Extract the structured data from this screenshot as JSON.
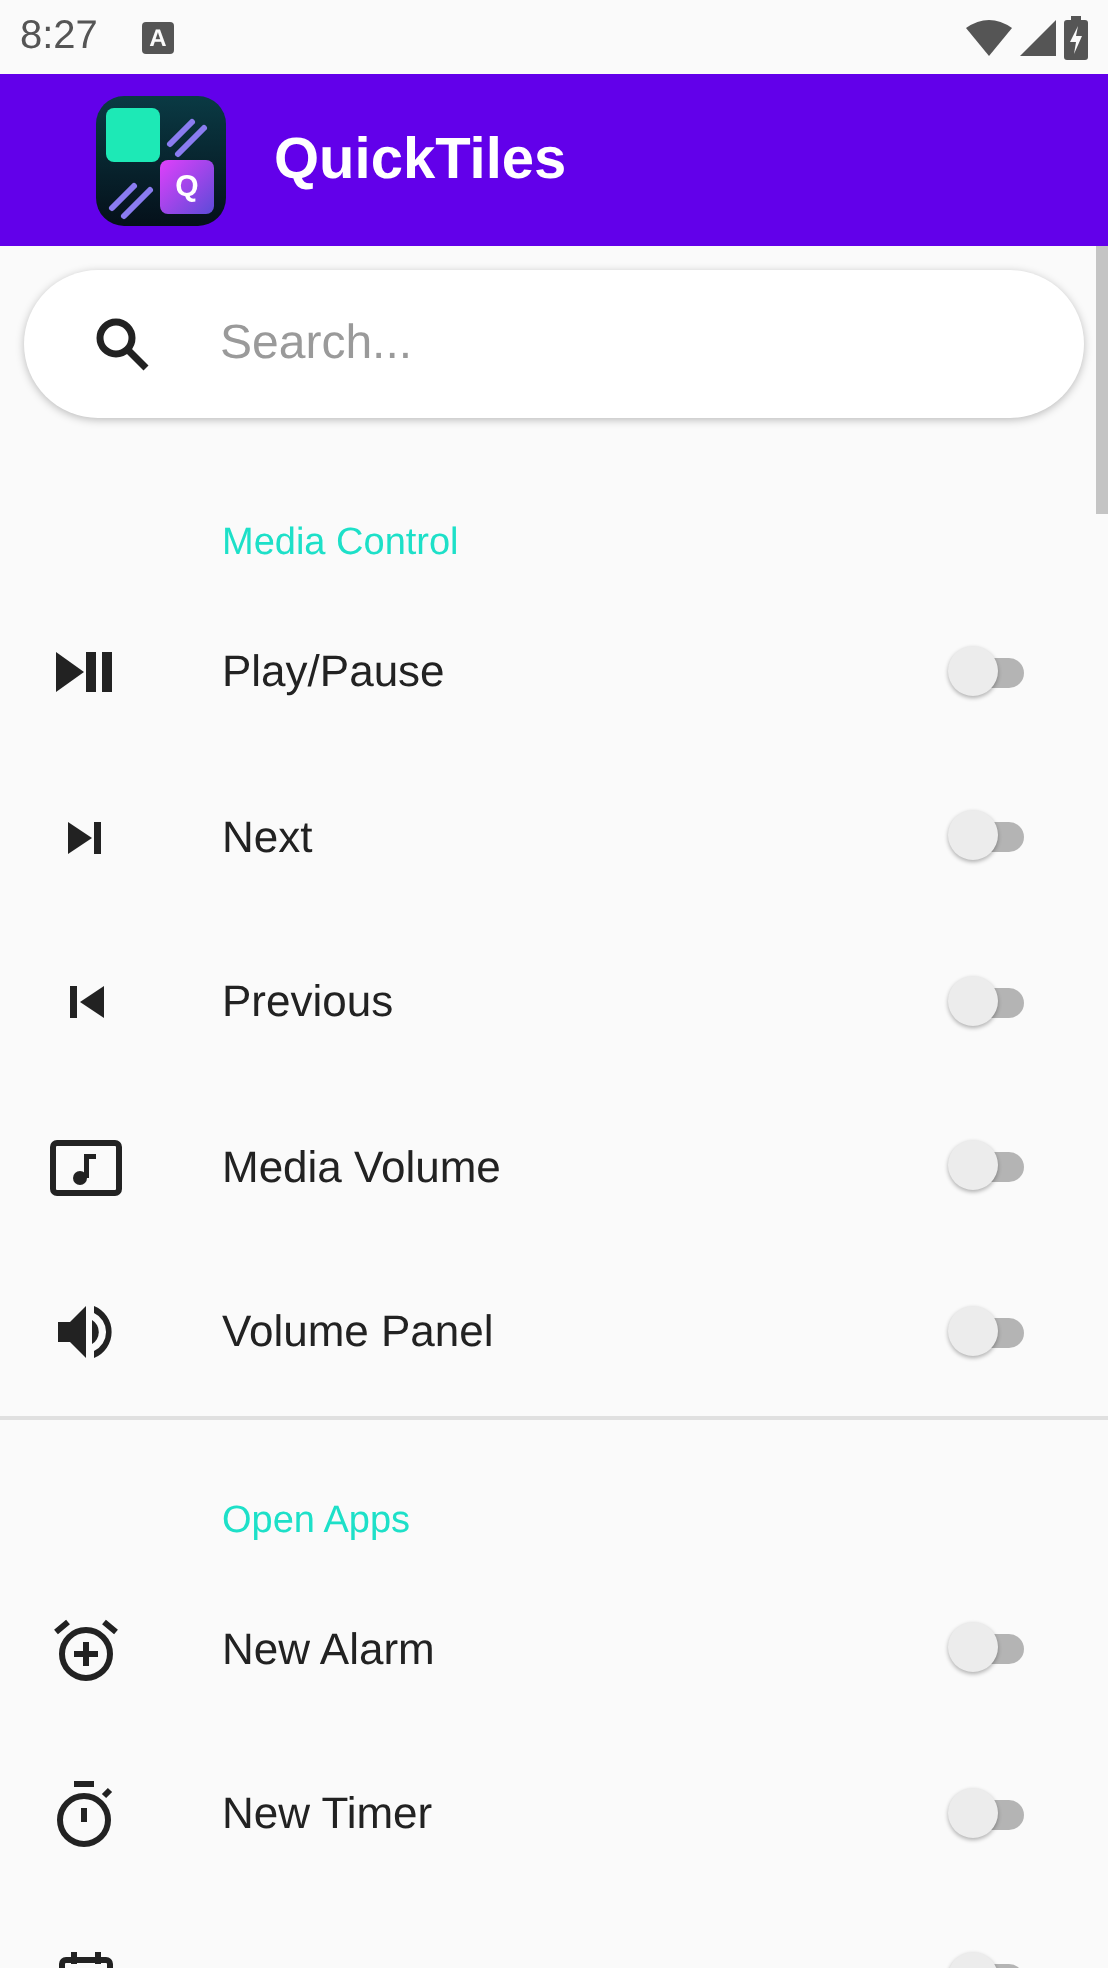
{
  "status_bar": {
    "time": "8:27",
    "notification": "A"
  },
  "app_bar": {
    "title": "QuickTiles",
    "logo_letter": "Q"
  },
  "search": {
    "placeholder": "Search..."
  },
  "sections": [
    {
      "title": "Media Control",
      "divider": true,
      "items": [
        {
          "label": "Play/Pause",
          "on": false
        },
        {
          "label": "Next",
          "on": false
        },
        {
          "label": "Previous",
          "on": false
        },
        {
          "label": "Media Volume",
          "on": false
        },
        {
          "label": "Volume Panel",
          "on": false
        }
      ]
    },
    {
      "title": "Open Apps",
      "items": [
        {
          "label": "New Alarm",
          "on": false
        },
        {
          "label": "New Timer",
          "on": false
        },
        {
          "on": false
        }
      ]
    }
  ]
}
